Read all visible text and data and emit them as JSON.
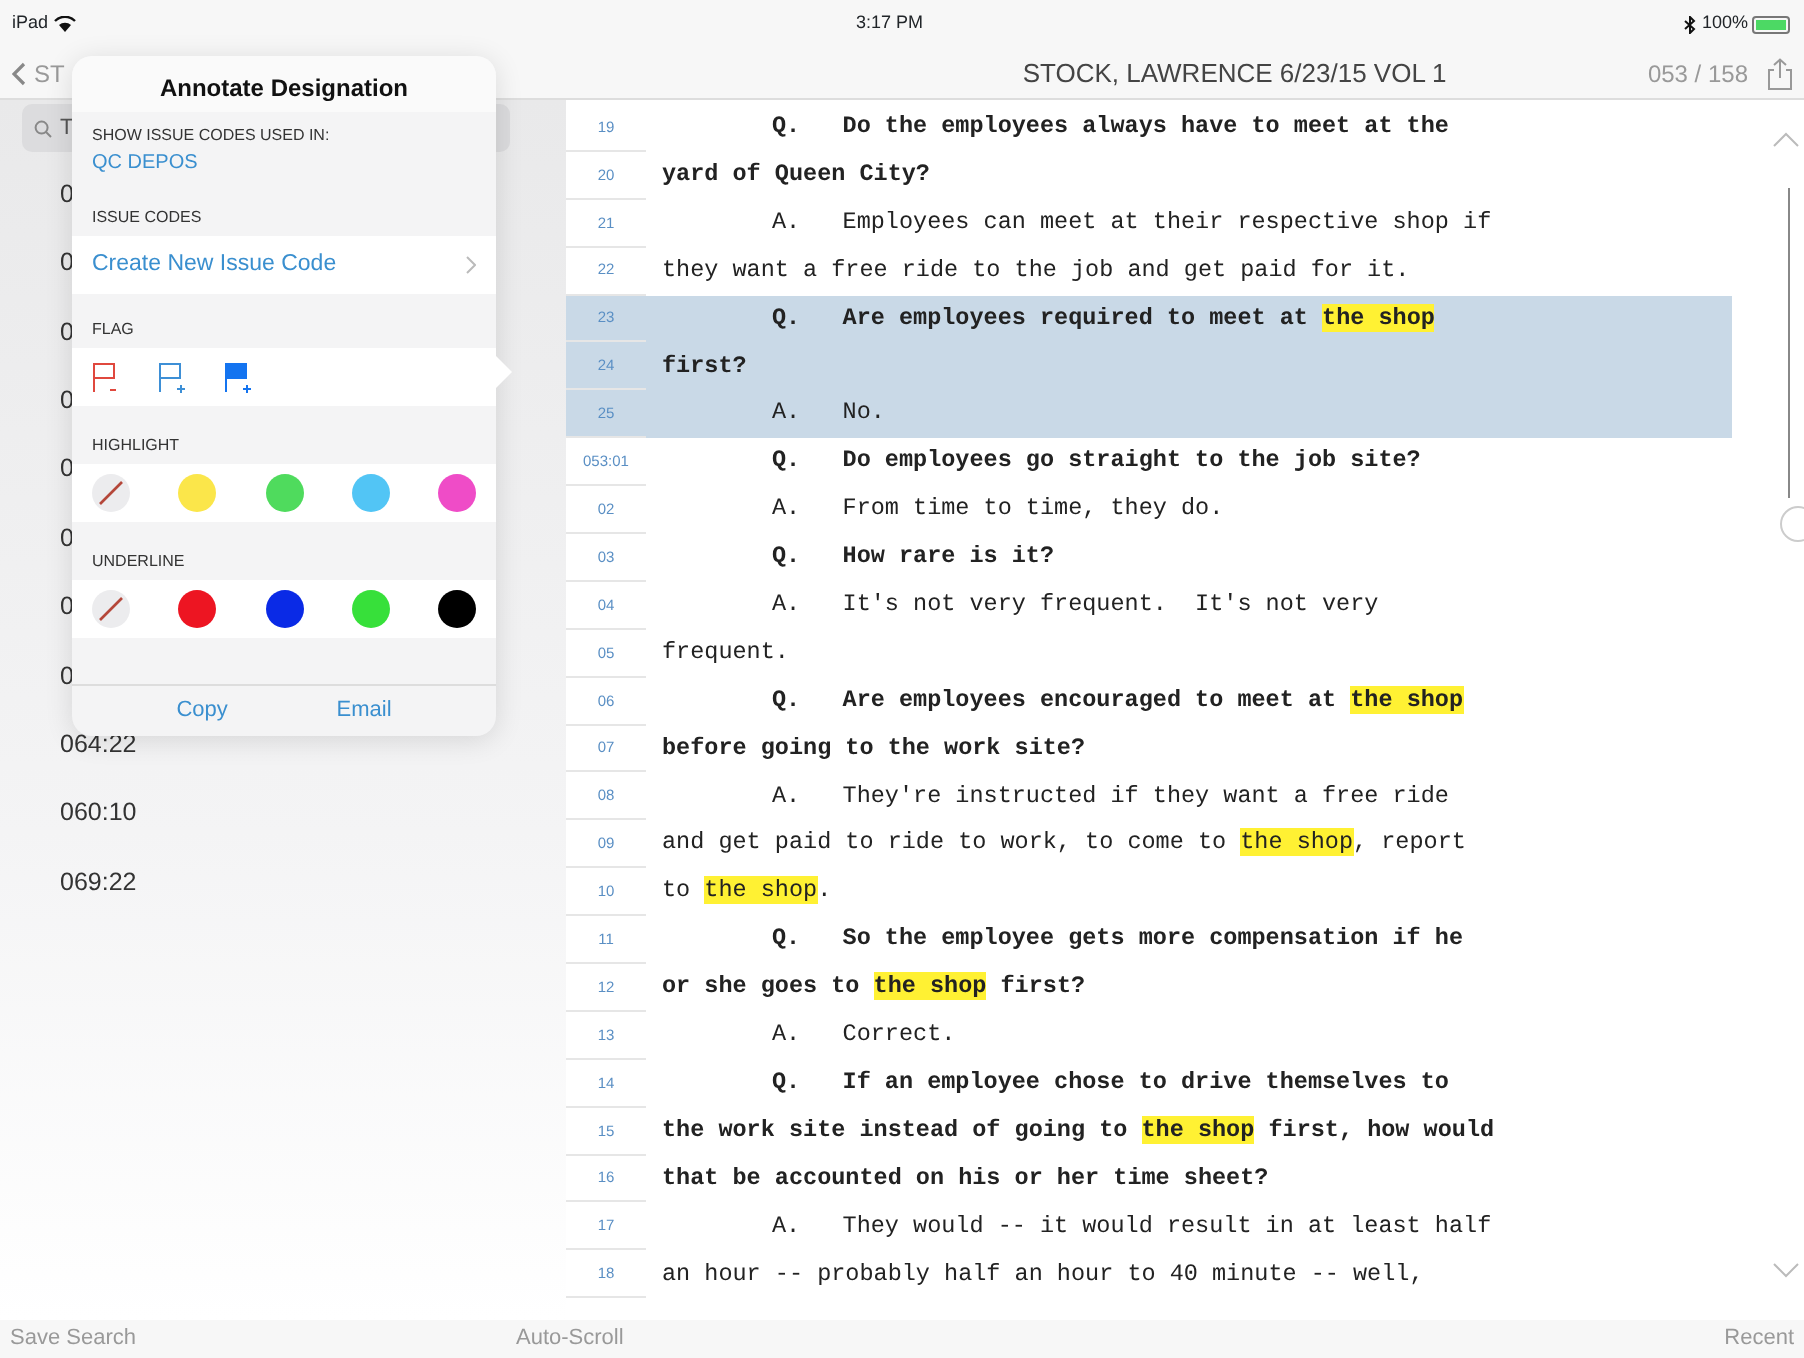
{
  "status_bar": {
    "device": "iPad",
    "time": "3:17 PM",
    "battery": "100%"
  },
  "nav_bar": {
    "back": "ST",
    "title": "STOCK, LAWRENCE 6/23/15 VOL 1",
    "page": "053 / 158"
  },
  "sidebar": {
    "search_value": "T",
    "items": [
      {
        "label": "0"
      },
      {
        "label": "0"
      },
      {
        "label": "0"
      },
      {
        "label": "0"
      },
      {
        "label": "0"
      },
      {
        "label": "0"
      },
      {
        "label": "0"
      },
      {
        "label": "0"
      },
      {
        "label": "064:22"
      },
      {
        "label": "060:10"
      },
      {
        "label": "069:22"
      }
    ]
  },
  "popover": {
    "title": "Annotate Designation",
    "show_label": "SHOW ISSUE CODES USED IN:",
    "show_value": "QC DEPOS",
    "issue_header": "ISSUE CODES",
    "issue_action": "Create New Issue Code",
    "flag_header": "FLAG",
    "flags": [
      {
        "kind": "remove",
        "color": "#e0483e"
      },
      {
        "kind": "add",
        "color": "#3d8fd6"
      },
      {
        "kind": "add-filled",
        "color": "#1474f0"
      }
    ],
    "highlight_header": "HIGHLIGHT",
    "highlight_swatches": [
      {
        "kind": "none"
      },
      {
        "kind": "color",
        "color": "#fbe64a"
      },
      {
        "kind": "color",
        "color": "#4fdb5d"
      },
      {
        "kind": "color",
        "color": "#52c5f5"
      },
      {
        "kind": "color",
        "color": "#ef4cc7"
      }
    ],
    "underline_header": "UNDERLINE",
    "underline_swatches": [
      {
        "kind": "none"
      },
      {
        "kind": "color",
        "color": "#ed1522"
      },
      {
        "kind": "color",
        "color": "#0a2ae6"
      },
      {
        "kind": "color",
        "color": "#37e03a"
      },
      {
        "kind": "color",
        "color": "#000000"
      }
    ],
    "buttons": [
      "Copy",
      "Email"
    ]
  },
  "transcript": {
    "lines": [
      {
        "number": "19",
        "speaker": "Q.",
        "bold": true,
        "selected": false,
        "segments": [
          {
            "text": "Do the employees always have to meet at the",
            "highlight": false
          }
        ]
      },
      {
        "number": "20",
        "bold": true,
        "selected": false,
        "segments": [
          {
            "text": "yard of Queen City?",
            "highlight": false
          }
        ]
      },
      {
        "number": "21",
        "speaker": "A.",
        "bold": false,
        "selected": false,
        "segments": [
          {
            "text": "Employees can meet at their respective shop if",
            "highlight": false
          }
        ]
      },
      {
        "number": "22",
        "bold": false,
        "selected": false,
        "segments": [
          {
            "text": "they want a free ride to the job and get paid for it.",
            "highlight": false
          }
        ]
      },
      {
        "number": "23",
        "speaker": "Q.",
        "bold": true,
        "selected": true,
        "segments": [
          {
            "text": "Are employees required to meet at ",
            "highlight": false
          },
          {
            "text": "the shop",
            "highlight": true
          }
        ]
      },
      {
        "number": "24",
        "bold": true,
        "selected": true,
        "segments": [
          {
            "text": "first?",
            "highlight": false
          }
        ]
      },
      {
        "number": "25",
        "speaker": "A.",
        "bold": false,
        "selected": true,
        "segments": [
          {
            "text": "No.",
            "highlight": false
          }
        ]
      },
      {
        "number": "053:01",
        "speaker": "Q.",
        "bold": true,
        "selected": false,
        "segments": [
          {
            "text": "Do employees go straight to the job site?",
            "highlight": false
          }
        ]
      },
      {
        "number": "02",
        "speaker": "A.",
        "bold": false,
        "selected": false,
        "segments": [
          {
            "text": "From time to time, they do.",
            "highlight": false
          }
        ]
      },
      {
        "number": "03",
        "speaker": "Q.",
        "bold": true,
        "selected": false,
        "segments": [
          {
            "text": "How rare is it?",
            "highlight": false
          }
        ]
      },
      {
        "number": "04",
        "speaker": "A.",
        "bold": false,
        "selected": false,
        "segments": [
          {
            "text": "It's not very frequent.  It's not very",
            "highlight": false
          }
        ]
      },
      {
        "number": "05",
        "bold": false,
        "selected": false,
        "segments": [
          {
            "text": "frequent.",
            "highlight": false
          }
        ]
      },
      {
        "number": "06",
        "speaker": "Q.",
        "bold": true,
        "selected": false,
        "segments": [
          {
            "text": "Are employees encouraged to meet at ",
            "highlight": false
          },
          {
            "text": "the shop",
            "highlight": true
          }
        ]
      },
      {
        "number": "07",
        "bold": true,
        "selected": false,
        "segments": [
          {
            "text": "before going to the work site?",
            "highlight": false
          }
        ]
      },
      {
        "number": "08",
        "speaker": "A.",
        "bold": false,
        "selected": false,
        "segments": [
          {
            "text": "They're instructed if they want a free ride",
            "highlight": false
          }
        ]
      },
      {
        "number": "09",
        "bold": false,
        "selected": false,
        "segments": [
          {
            "text": "and get paid to ride to work, to come to ",
            "highlight": false
          },
          {
            "text": "the shop",
            "highlight": true
          },
          {
            "text": ", report",
            "highlight": false
          }
        ]
      },
      {
        "number": "10",
        "bold": false,
        "selected": false,
        "segments": [
          {
            "text": "to ",
            "highlight": false
          },
          {
            "text": "the shop",
            "highlight": true
          },
          {
            "text": ".",
            "highlight": false
          }
        ]
      },
      {
        "number": "11",
        "speaker": "Q.",
        "bold": true,
        "selected": false,
        "segments": [
          {
            "text": "So the employee gets more compensation if he",
            "highlight": false
          }
        ]
      },
      {
        "number": "12",
        "bold": true,
        "selected": false,
        "segments": [
          {
            "text": "or she goes to ",
            "highlight": false
          },
          {
            "text": "the shop",
            "highlight": true
          },
          {
            "text": " first?",
            "highlight": false
          }
        ]
      },
      {
        "number": "13",
        "speaker": "A.",
        "bold": false,
        "selected": false,
        "segments": [
          {
            "text": "Correct.",
            "highlight": false
          }
        ]
      },
      {
        "number": "14",
        "speaker": "Q.",
        "bold": true,
        "selected": false,
        "segments": [
          {
            "text": "If an employee chose to drive themselves to",
            "highlight": false
          }
        ]
      },
      {
        "number": "15",
        "bold": true,
        "selected": false,
        "segments": [
          {
            "text": "the work site instead of going to ",
            "highlight": false
          },
          {
            "text": "the shop",
            "highlight": true
          },
          {
            "text": " first, how would",
            "highlight": false
          }
        ]
      },
      {
        "number": "16",
        "bold": true,
        "selected": false,
        "segments": [
          {
            "text": "that be accounted on his or her time sheet?",
            "highlight": false
          }
        ]
      },
      {
        "number": "17",
        "speaker": "A.",
        "bold": false,
        "selected": false,
        "segments": [
          {
            "text": "They would -- it would result in at least half",
            "highlight": false
          }
        ]
      },
      {
        "number": "18",
        "bold": false,
        "selected": false,
        "segments": [
          {
            "text": "an hour -- probably half an hour to 40 minute -- well,",
            "highlight": false
          }
        ]
      }
    ]
  },
  "toolbar": [
    "Save Search",
    "Auto-Scroll",
    "Recent"
  ]
}
